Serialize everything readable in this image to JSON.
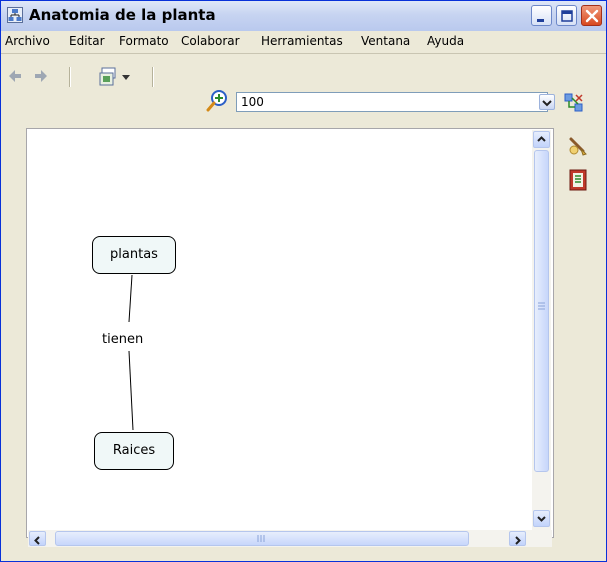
{
  "window": {
    "title": "Anatomia de la planta",
    "icon": "concept-map-app-icon",
    "controls": [
      "minimize-icon",
      "maximize-icon",
      "close-icon"
    ]
  },
  "menu": [
    "Archivo",
    "Editar",
    "Formato",
    "Colaborar",
    "Herramientas",
    "Ventana",
    "Ayuda"
  ],
  "toolbar": {
    "icons": [
      "back-arrow-icon",
      "forward-arrow-icon",
      "view-options-icon",
      "zoom-icon",
      "zoom-dropdown-icon",
      "network-icon"
    ],
    "zoom_value": "100"
  },
  "sidebar_icons": [
    "styles-palette-icon",
    "notes-book-icon"
  ],
  "concept_map": {
    "concepts": [
      {
        "label": "plantas"
      },
      {
        "label": "Raices"
      }
    ],
    "link_phrase": "tienen"
  },
  "scrollbars": {
    "vertical": [
      "scroll-up-icon",
      "scroll-down-icon"
    ],
    "horizontal": [
      "scroll-left-icon",
      "scroll-right-icon"
    ]
  },
  "colors": {
    "concept_fill": "#f0f8f8",
    "titlebar": "#c7d4f1",
    "close_button": "#d8491f",
    "window_border": "#0831d9"
  }
}
